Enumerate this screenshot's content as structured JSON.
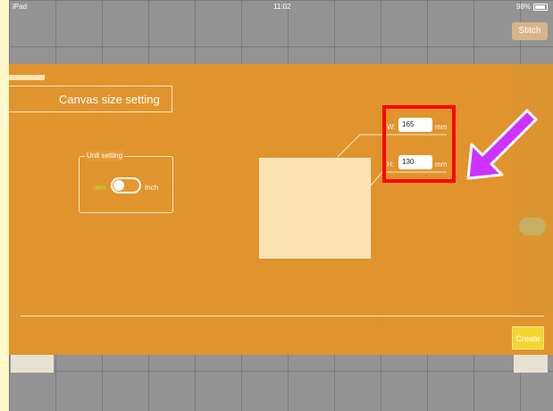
{
  "status_bar": {
    "device": "iPad",
    "time": "11:02",
    "battery": "98%"
  },
  "toolbar": {
    "stitch_label": "Stitch"
  },
  "dialog": {
    "title": "Canvas size setting",
    "unit_setting": {
      "legend": "Unit setting",
      "option_mm": "mm",
      "option_inch": "Inch",
      "selected": "mm"
    },
    "width": {
      "label": "W:",
      "value": "165",
      "unit": "mm"
    },
    "height": {
      "label": "H:",
      "value": "130",
      "unit": "mm"
    },
    "create_label": "Create"
  },
  "annotations": {
    "highlight_color": "#ff0000",
    "arrow_color": "#cc33ff"
  },
  "colors": {
    "overlay": "#e79426",
    "preview": "#fde2b2",
    "create_button": "#f5d530",
    "mm_selected": "#9ef33a"
  }
}
